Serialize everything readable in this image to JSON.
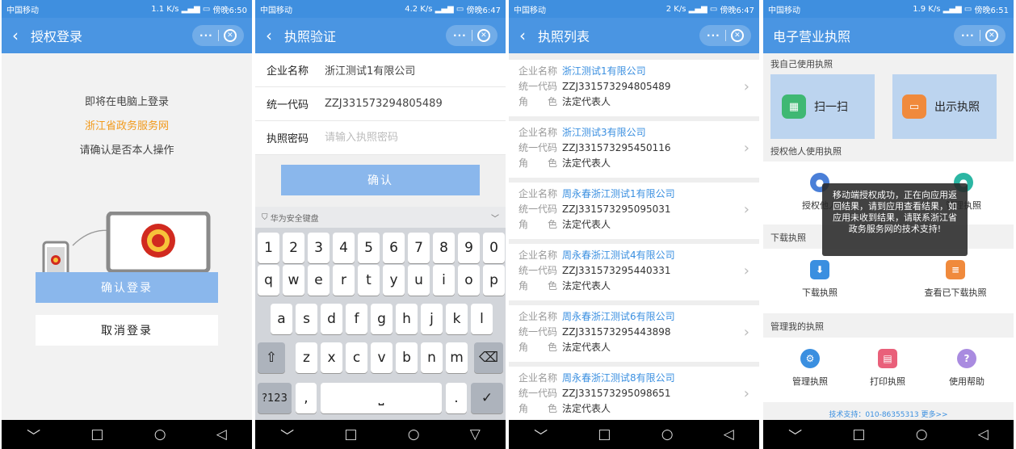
{
  "status_bars": [
    {
      "carrier": "中国移动",
      "speed": "1.1 K/s",
      "time": "傍晚6:50"
    },
    {
      "carrier": "中国移动",
      "speed": "4.2 K/s",
      "time": "傍晚6:47"
    },
    {
      "carrier": "中国移动",
      "speed": "2 K/s",
      "time": "傍晚6:47"
    },
    {
      "carrier": "中国移动",
      "speed": "1.9 K/s",
      "time": "傍晚6:51"
    }
  ],
  "capsule": {
    "more": "···",
    "close": "⊗"
  },
  "nav": {
    "back": "﹀",
    "home": "□",
    "circle": "○",
    "triangle": "◁",
    "triangle_down": "▽"
  },
  "screen1": {
    "title": "授权登录",
    "line1": "即将在电脑上登录",
    "site": "浙江省政务服务网",
    "line3": "请确认是否本人操作",
    "confirm": "确认登录",
    "cancel": "取消登录"
  },
  "screen2": {
    "title": "执照验证",
    "fields": [
      {
        "label": "企业名称",
        "value": "浙江测试1有限公司"
      },
      {
        "label": "统一代码",
        "value": "ZZJ331573294805489"
      },
      {
        "label": "执照密码",
        "placeholder": "请输入执照密码"
      }
    ],
    "ok": "确认",
    "keyboard_title": "华为安全键盘",
    "row_num": [
      "1",
      "2",
      "3",
      "4",
      "5",
      "6",
      "7",
      "8",
      "9",
      "0"
    ],
    "row1": [
      "q",
      "w",
      "e",
      "r",
      "t",
      "y",
      "u",
      "i",
      "o",
      "p"
    ],
    "row2": [
      "a",
      "s",
      "d",
      "f",
      "g",
      "h",
      "j",
      "k",
      "l"
    ],
    "row3": [
      "z",
      "x",
      "c",
      "v",
      "b",
      "n",
      "m"
    ],
    "shift": "⇧",
    "backspace": "⌫",
    "sym": "?123",
    "comma": ",",
    "space": "⎵",
    "period": ".",
    "done": "✓",
    "collapse": "﹀"
  },
  "screen3": {
    "title": "执照列表",
    "label_name": "企业名称",
    "label_code": "统一代码",
    "label_role": "角　　色",
    "items": [
      {
        "name": "浙江测试1有限公司",
        "code": "ZZJ331573294805489",
        "role": "法定代表人"
      },
      {
        "name": "浙江测试3有限公司",
        "code": "ZZJ331573295450116",
        "role": "法定代表人"
      },
      {
        "name": "周永春浙江测试1有限公司",
        "code": "ZZJ331573295095031",
        "role": "法定代表人"
      },
      {
        "name": "周永春浙江测试4有限公司",
        "code": "ZZJ331573295440331",
        "role": "法定代表人"
      },
      {
        "name": "周永春浙江测试6有限公司",
        "code": "ZZJ331573295443898",
        "role": "法定代表人"
      },
      {
        "name": "周永春浙江测试8有限公司",
        "code": "ZZJ331573295098651",
        "role": "法定代表人"
      }
    ]
  },
  "screen4": {
    "title": "电子营业执照",
    "sec_self": "我自己使用执照",
    "scan": "扫一扫",
    "show": "出示执照",
    "sec_auth": "授权他人使用执照",
    "auth_left": "授权他人",
    "auth_right": "管理执照",
    "sec_download": "下载执照",
    "download": "下载执照",
    "view_downloaded": "查看已下载执照",
    "sec_manage": "管理我的执照",
    "manage": "管理执照",
    "print": "打印执照",
    "help": "使用帮助",
    "toast": "移动端授权成功，正在向应用返回结果，请到应用查看结果，如应用未收到结果，请联系浙江省政务服务网的技术支持!",
    "footer": "技术支持：010-86355313  更多>>"
  },
  "colors": {
    "titlebar": "#4a95e2",
    "status": "#3f8fdf",
    "button": "#8ab7ec",
    "orange": "#f29a1c",
    "link": "#3a8fe0"
  }
}
